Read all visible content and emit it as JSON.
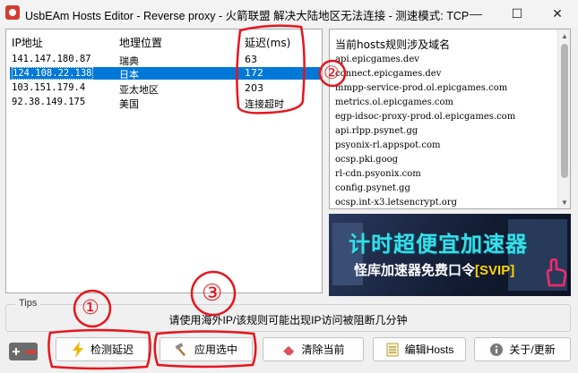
{
  "window": {
    "title": "UsbEAm Hosts Editor - Reverse proxy - 火箭联盟 解决大陆地区无法连接 - 测速模式: TCP",
    "controls": [
      "—",
      "☐",
      "✕"
    ]
  },
  "ip_list": {
    "headers": [
      "IP地址",
      "地理位置",
      "延迟(ms)"
    ],
    "rows": [
      {
        "ip": "141.147.180.87",
        "location": "瑞典",
        "latency": "63"
      },
      {
        "ip": "124.108.22.138",
        "location": "日本",
        "latency": "172"
      },
      {
        "ip": "103.151.179.4",
        "location": "亚太地区",
        "latency": "203"
      },
      {
        "ip": "92.38.149.175",
        "location": "美国",
        "latency": "连接超时"
      }
    ]
  },
  "domains_panel": {
    "title": "当前hosts规则涉及域名",
    "domains": [
      "api.epicgames.dev",
      "connect.epicgames.dev",
      "mmpp-service-prod.ol.epicgames.com",
      "metrics.ol.epicgames.com",
      "egp-idsoc-proxy-prod.ol.epicgames.com",
      "api.rlpp.psynet.gg",
      "psyonix-rl.appspot.com",
      "ocsp.pki.goog",
      "rl-cdn.psyonix.com",
      "config.psynet.gg",
      "ocsp.int-x3.letsencrypt.org"
    ]
  },
  "ad": {
    "line1": "计时超便宜加速器",
    "line2": "怪库加速器免费口令",
    "line2_code": "[SVIP]"
  },
  "tips": {
    "label": "Tips",
    "message": "请使用海外IP/该规则可能出现IP访问被阻断几分钟"
  },
  "buttons": {
    "test_latency": "检测延迟",
    "apply_selected": "应用选中",
    "clear_current": "清除当前",
    "edit_hosts": "编辑Hosts",
    "about_update": "关于/更新"
  },
  "annotations": [
    "①",
    "②",
    "③"
  ],
  "colors": {
    "selection": "#0078d7",
    "annotation": "#e8141b",
    "ad_headline": "#35e0e8"
  }
}
